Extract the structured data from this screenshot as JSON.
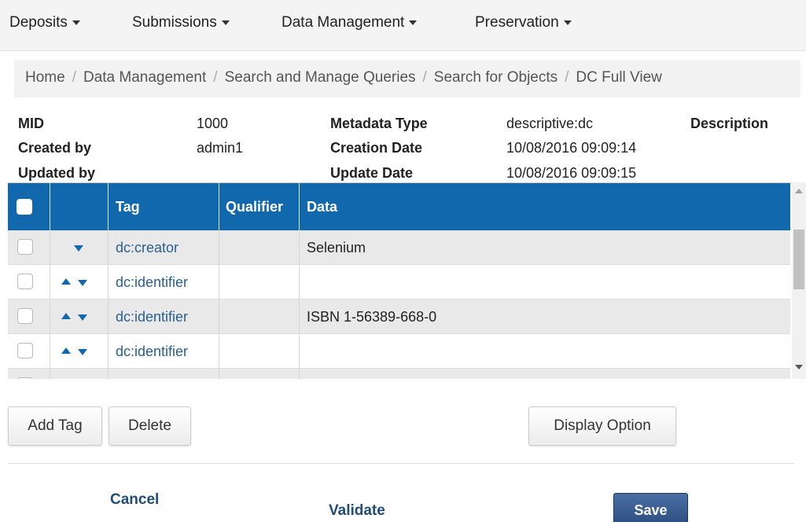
{
  "nav": {
    "items": [
      {
        "label": "Deposits"
      },
      {
        "label": "Submissions"
      },
      {
        "label": "Data Management"
      },
      {
        "label": "Preservation"
      }
    ]
  },
  "breadcrumb": [
    "Home",
    "Data Management",
    "Search and Manage Queries",
    "Search for Objects",
    "DC Full View"
  ],
  "meta": {
    "mid_label": "MID",
    "mid_value": "1000",
    "created_by_label": "Created by",
    "created_by_value": "admin1",
    "updated_by_label": "Updated by",
    "metadata_type_label": "Metadata Type",
    "metadata_type_value": "descriptive:dc",
    "creation_date_label": "Creation Date",
    "creation_date_value": "10/08/2016 09:09:14",
    "update_date_label": "Update Date",
    "update_date_value": "10/08/2016 09:09:15",
    "description_label": "Description"
  },
  "grid": {
    "header_color": "#1268ad",
    "columns": {
      "tag": "Tag",
      "qualifier": "Qualifier",
      "data": "Data"
    },
    "rows": [
      {
        "tag": "dc:creator",
        "qualifier": "",
        "data": "Selenium",
        "arrows": [
          "down"
        ]
      },
      {
        "tag": "dc:identifier",
        "qualifier": "",
        "data": "",
        "arrows": [
          "up",
          "down"
        ]
      },
      {
        "tag": "dc:identifier",
        "qualifier": "",
        "data": "ISBN 1-56389-668-0",
        "arrows": [
          "up",
          "down"
        ]
      },
      {
        "tag": "dc:identifier",
        "qualifier": "",
        "data": "",
        "arrows": [
          "up",
          "down"
        ]
      }
    ]
  },
  "actions": {
    "add_tag": "Add Tag",
    "delete": "Delete",
    "display_option": "Display Option",
    "cancel": "Cancel",
    "validate": "Validate",
    "save": "Save"
  }
}
